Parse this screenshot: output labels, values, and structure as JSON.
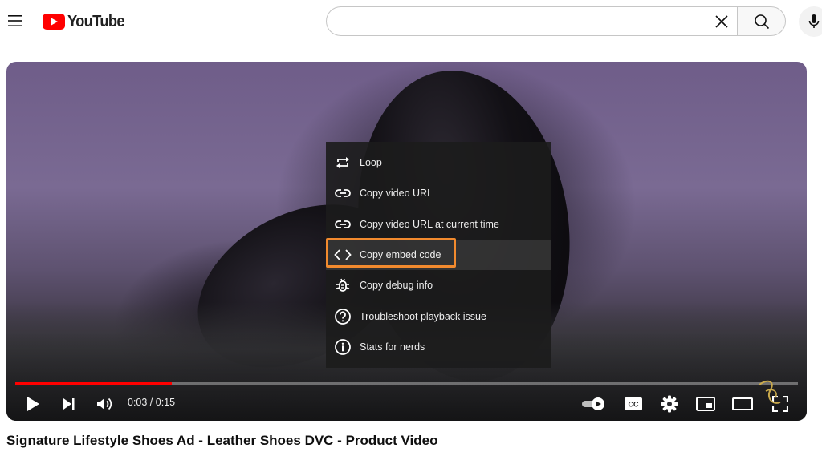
{
  "header": {
    "logo_text": "YouTube",
    "search": {
      "value": "",
      "placeholder": ""
    }
  },
  "player": {
    "time_display": "0:03 / 0:15",
    "progress_fraction": 0.2
  },
  "context_menu": {
    "items": [
      {
        "label": "Loop",
        "icon": "loop-icon"
      },
      {
        "label": "Copy video URL",
        "icon": "link-icon"
      },
      {
        "label": "Copy video URL at current time",
        "icon": "link-icon"
      },
      {
        "label": "Copy embed code",
        "icon": "embed-code-icon",
        "highlighted": true
      },
      {
        "label": "Copy debug info",
        "icon": "bug-icon"
      },
      {
        "label": "Troubleshoot playback issue",
        "icon": "help-icon"
      },
      {
        "label": "Stats for nerds",
        "icon": "info-icon"
      }
    ]
  },
  "video": {
    "title": "Signature Lifestyle Shoes Ad - Leather Shoes DVC - Product Video"
  },
  "colors": {
    "brand_red": "#ff0000",
    "highlight_orange": "#f28a2e",
    "progress_red": "#ff0000"
  }
}
